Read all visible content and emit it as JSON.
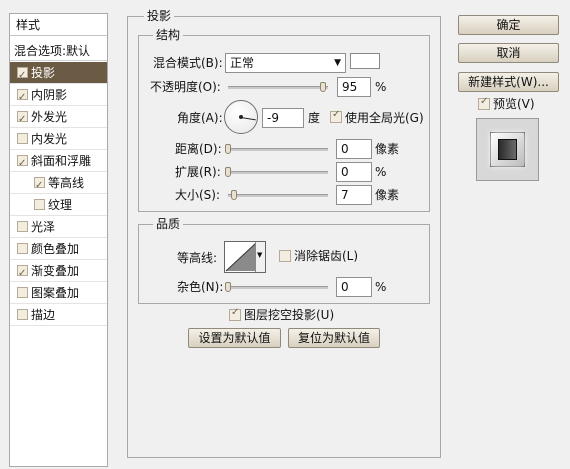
{
  "style_list": {
    "header": "样式",
    "blend_options": "混合选项:默认",
    "items": [
      {
        "label": "投影",
        "checked": true,
        "selected": true
      },
      {
        "label": "内阴影",
        "checked": true
      },
      {
        "label": "外发光",
        "checked": true
      },
      {
        "label": "内发光",
        "checked": false
      },
      {
        "label": "斜面和浮雕",
        "checked": true
      },
      {
        "label": "等高线",
        "checked": true
      },
      {
        "label": "纹理",
        "checked": false
      },
      {
        "label": "光泽",
        "checked": false
      },
      {
        "label": "颜色叠加",
        "checked": false
      },
      {
        "label": "渐变叠加",
        "checked": true
      },
      {
        "label": "图案叠加",
        "checked": false
      },
      {
        "label": "描边",
        "checked": false
      }
    ]
  },
  "panel": {
    "title": "投影",
    "structure": {
      "title": "结构",
      "blend_mode_label": "混合模式(B):",
      "blend_mode_value": "正常",
      "opacity_label": "不透明度(O):",
      "opacity_value": "95",
      "opacity_unit": "%",
      "opacity_level": 0.95,
      "angle_label": "角度(A):",
      "angle_value": "-9",
      "angle_unit": "度",
      "global_light_label": "使用全局光(G)",
      "global_light_checked": true,
      "distance_label": "距离(D):",
      "distance_value": "0",
      "distance_unit": "像素",
      "spread_label": "扩展(R):",
      "spread_value": "0",
      "spread_unit": "%",
      "size_label": "大小(S):",
      "size_value": "7",
      "size_unit": "像素"
    },
    "quality": {
      "title": "品质",
      "contour_label": "等高线:",
      "antialias_label": "消除锯齿(L)",
      "antialias_checked": false,
      "noise_label": "杂色(N):",
      "noise_value": "0",
      "noise_unit": "%"
    },
    "knockout_label": "图层挖空投影(U)",
    "knockout_checked": true,
    "make_default_button": "设置为默认值",
    "reset_default_button": "复位为默认值"
  },
  "right": {
    "ok_button": "确定",
    "cancel_button": "取消",
    "new_style_button": "新建样式(W)...",
    "preview_label": "预览(V)",
    "preview_checked": true
  },
  "colors": {
    "selected_row": "#6b5a44",
    "shadow_swatch": "#ffffff"
  }
}
